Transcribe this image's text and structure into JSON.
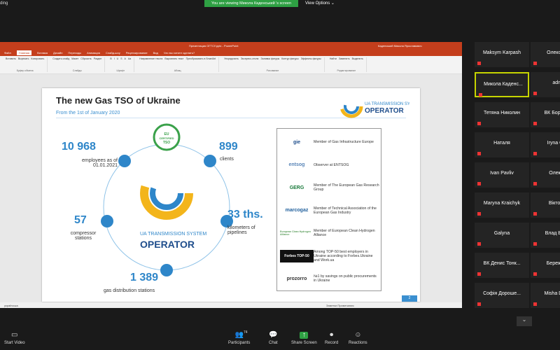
{
  "zoom": {
    "recording_label": "ding",
    "banner": "You are viewing Микола Каденський 's screen",
    "view_options": "View Options"
  },
  "ppt": {
    "title": "Презентация ОГТСУ.pptx - PowerPoint",
    "user": "Каденський Микола Ярославович",
    "menu": [
      "Файл",
      "Главная",
      "Вставка",
      "Дизайн",
      "Переходы",
      "Анимация",
      "Слайд-шоу",
      "Рецензирование",
      "Вид",
      "Что вы хотите сделать?"
    ],
    "ribbon_groups": [
      {
        "label": "Буфер обмена",
        "items": [
          "Вставить",
          "Вырезать",
          "Копировать"
        ]
      },
      {
        "label": "Слайды",
        "items": [
          "Создать слайд",
          "Макет",
          "Сбросить",
          "Раздел"
        ]
      },
      {
        "label": "Шрифт",
        "items": [
          "B",
          "I",
          "U",
          "S",
          "A",
          "Aa"
        ]
      },
      {
        "label": "Абзац",
        "items": [
          "Направление текста",
          "Выровнять текст",
          "Преобразовать в SmartArt"
        ]
      },
      {
        "label": "Рисование",
        "items": [
          "Упорядочить",
          "Экспресс-стили",
          "Заливка фигуры",
          "Контур фигуры",
          "Эффекты фигуры"
        ]
      },
      {
        "label": "Редактирование",
        "items": [
          "Найти",
          "Заменить",
          "Выделить"
        ]
      }
    ],
    "status_left": "українська",
    "status_right": "Заметки   Примечания"
  },
  "slide": {
    "title": "The new Gas TSO of Ukraine",
    "subtitle": "From the 1st of January 2020",
    "logo_text": "OPERATOR",
    "logo_small": "UA TRANSMISSION SYSTEM",
    "badge": "EU CERTIFIED TSO",
    "stats": [
      {
        "value": "10 968",
        "label": "employees as of 01.01.2021"
      },
      {
        "value": "899",
        "label": "clients"
      },
      {
        "value": "57",
        "label": "compressor stations"
      },
      {
        "value": "33 ths.",
        "label": "kilometers of pipelines"
      },
      {
        "value": "1 389",
        "label": "gas distribution stations"
      }
    ],
    "members": [
      {
        "logo": "gie",
        "text": "Member of Gas Infrastructure Europe",
        "color": "#1f4e8c"
      },
      {
        "logo": "entsog",
        "text": "Observer at ENTSOG",
        "color": "#5a86b8"
      },
      {
        "logo": "GERG",
        "text": "Member of The European Gas Research Group",
        "color": "#1a7a3c"
      },
      {
        "logo": "marcogaz",
        "text": "Member of Technical Association of the European Gas Industry",
        "color": "#1f5f9c"
      },
      {
        "logo": "European Clean Hydrogen Alliance",
        "text": "Member of European Clean Hydrogen Alliance",
        "color": "#5fa05f"
      },
      {
        "logo": "Forbes TOP-50",
        "text": "Among TOP-50 best employers in Ukraine according to Forbes.Ukraine and Work.ua",
        "color": "#111111"
      },
      {
        "logo": "prozorro",
        "text": "№1 by savings on public procurements in Ukraine",
        "color": "#333333"
      }
    ],
    "page": "2"
  },
  "gallery": [
    {
      "name": "Maksym Karpash",
      "selected": false
    },
    {
      "name": "Олександ",
      "selected": false
    },
    {
      "name": "Микола Каденс...",
      "selected": true
    },
    {
      "name": "admi",
      "selected": false
    },
    {
      "name": "Тетяна Николин",
      "selected": false
    },
    {
      "name": "ВК БорисБо",
      "selected": false
    },
    {
      "name": "Наталя",
      "selected": false
    },
    {
      "name": "Iryna Obo",
      "selected": false
    },
    {
      "name": "Ivan Pavliv",
      "selected": false
    },
    {
      "name": "Олексій",
      "selected": false
    },
    {
      "name": "Maryna Kraichyk",
      "selected": false
    },
    {
      "name": "Віктор К",
      "selected": false
    },
    {
      "name": "Galyna",
      "selected": false
    },
    {
      "name": "Влад Вишн",
      "selected": false
    },
    {
      "name": "ВК Денис Тонк...",
      "selected": false
    },
    {
      "name": "Бережний",
      "selected": false
    },
    {
      "name": "Софія Дороше...",
      "selected": false
    },
    {
      "name": "Misha Demy",
      "selected": false
    }
  ],
  "toolbar": {
    "start_video": "Start Video",
    "participants": "Participants",
    "participants_count": "74",
    "chat": "Chat",
    "share": "Share Screen",
    "record": "Record",
    "reactions": "Reactions"
  },
  "colors": {
    "accent": "#2e86c9",
    "ppt": "#c43e1c",
    "share": "#2ea043",
    "selected_tile": "#c6d400"
  }
}
